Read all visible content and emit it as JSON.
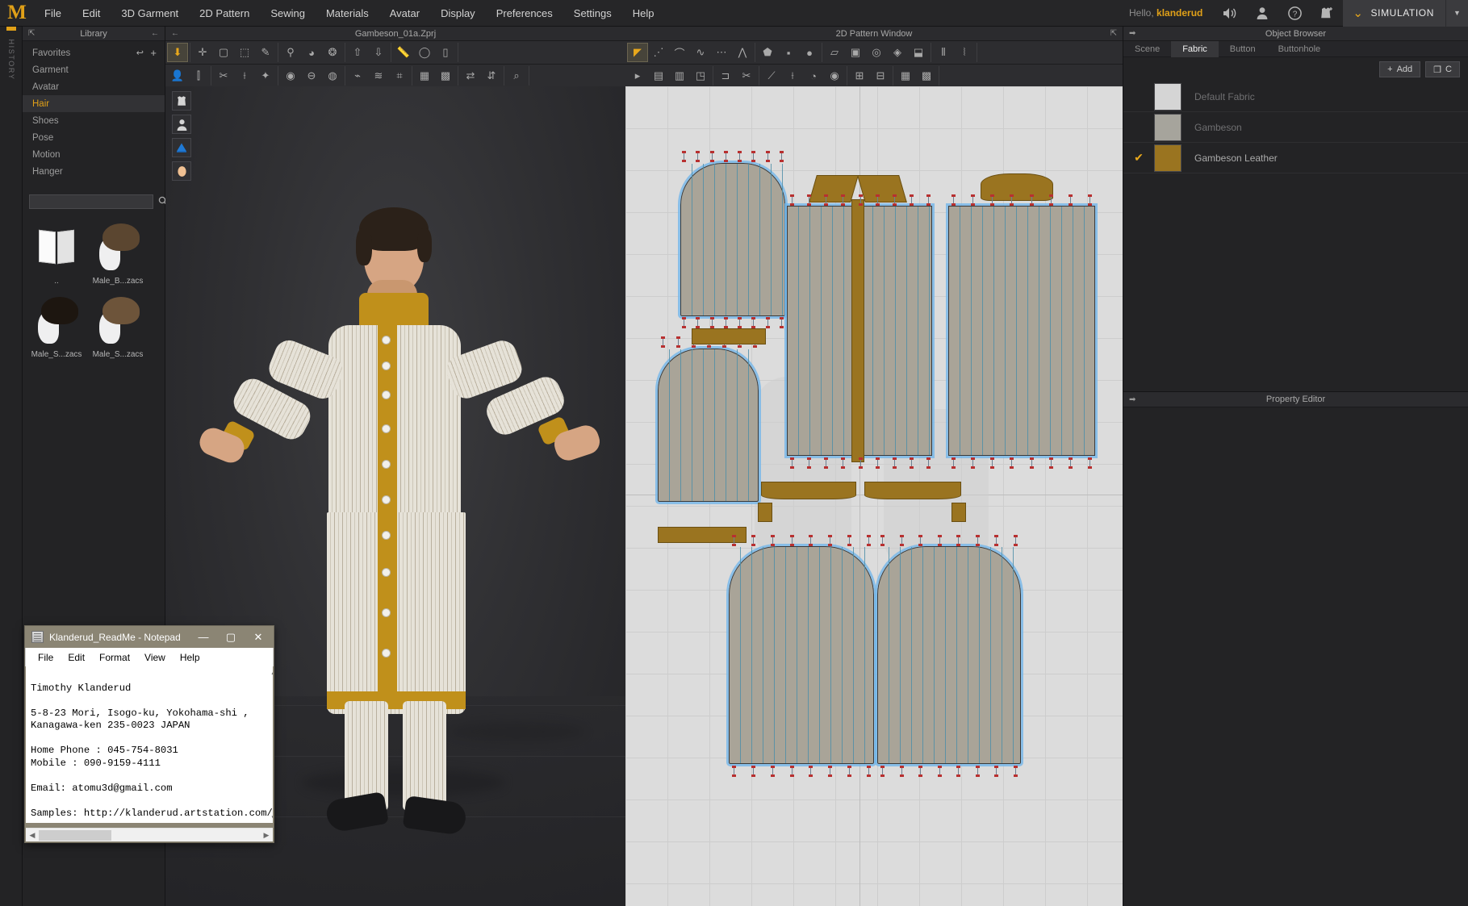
{
  "app": {
    "logo": "M",
    "menus": [
      "File",
      "Edit",
      "3D Garment",
      "2D Pattern",
      "Sewing",
      "Materials",
      "Avatar",
      "Display",
      "Preferences",
      "Settings",
      "Help"
    ],
    "greeting_prefix": "Hello,",
    "user": "klanderud",
    "simulation_label": "SIMULATION",
    "history_tab": "HISTORY"
  },
  "library": {
    "title": "Library",
    "items": [
      {
        "label": "Favorites",
        "selected": false
      },
      {
        "label": "Garment",
        "selected": false
      },
      {
        "label": "Avatar",
        "selected": false
      },
      {
        "label": "Hair",
        "selected": true
      },
      {
        "label": "Shoes",
        "selected": false
      },
      {
        "label": "Pose",
        "selected": false
      },
      {
        "label": "Motion",
        "selected": false
      },
      {
        "label": "Hanger",
        "selected": false
      }
    ],
    "search_value": "",
    "search_placeholder": "",
    "thumbnails": [
      {
        "caption": "..",
        "kind": "folder"
      },
      {
        "caption": "Male_B...zacs",
        "kind": "hair",
        "hair": "#5b4630"
      },
      {
        "caption": "Male_S...zacs",
        "kind": "hair",
        "hair": "#1d1610"
      },
      {
        "caption": "Male_S...zacs",
        "kind": "hair",
        "hair": "#6d543a"
      }
    ]
  },
  "view3d": {
    "title": "Gambeson_01a.Zprj",
    "tools": [
      "show-garment-toggle",
      "show-avatar-toggle",
      "show-pattern-toggle",
      "show-face-toggle"
    ]
  },
  "view2d": {
    "title": "2D Pattern Window"
  },
  "object_browser": {
    "title": "Object Browser",
    "tabs": [
      {
        "label": "Scene",
        "active": false
      },
      {
        "label": "Fabric",
        "active": true
      },
      {
        "label": "Button",
        "active": false
      },
      {
        "label": "Buttonhole",
        "active": false
      }
    ],
    "add_label": "Add",
    "copy_label": "C",
    "fabrics": [
      {
        "name": "Default Fabric",
        "color": "#d5d5d5",
        "checked": false,
        "dim": true
      },
      {
        "name": "Gambeson",
        "color": "#a6a49c",
        "checked": false,
        "dim": true
      },
      {
        "name": "Gambeson Leather",
        "color": "#9a7420",
        "checked": true,
        "dim": false
      }
    ]
  },
  "property_editor": {
    "title": "Property Editor"
  },
  "notepad": {
    "title": "Klanderud_ReadMe - Notepad",
    "menus": [
      "File",
      "Edit",
      "Format",
      "View",
      "Help"
    ],
    "window_buttons": [
      "minimize",
      "maximize",
      "close"
    ],
    "content": "\nTimothy Klanderud\n\n5-8-23 Mori, Isogo-ku, Yokohama-shi ,\nKanagawa-ken 235-0023 JAPAN\n\nHome Phone : 045-754-8031\nMobile : 090-9159-4111\n\nEmail: atomu3d@gmail.com\n\nSamples: http://klanderud.artstation.com/"
  },
  "colors": {
    "accent": "#e0a018",
    "panel": "#232325",
    "garment_cream": "#e2ded3",
    "garment_gold": "#c0901b",
    "pattern_fill": "#a9a498",
    "pattern_outline": "#6eb4eb"
  }
}
